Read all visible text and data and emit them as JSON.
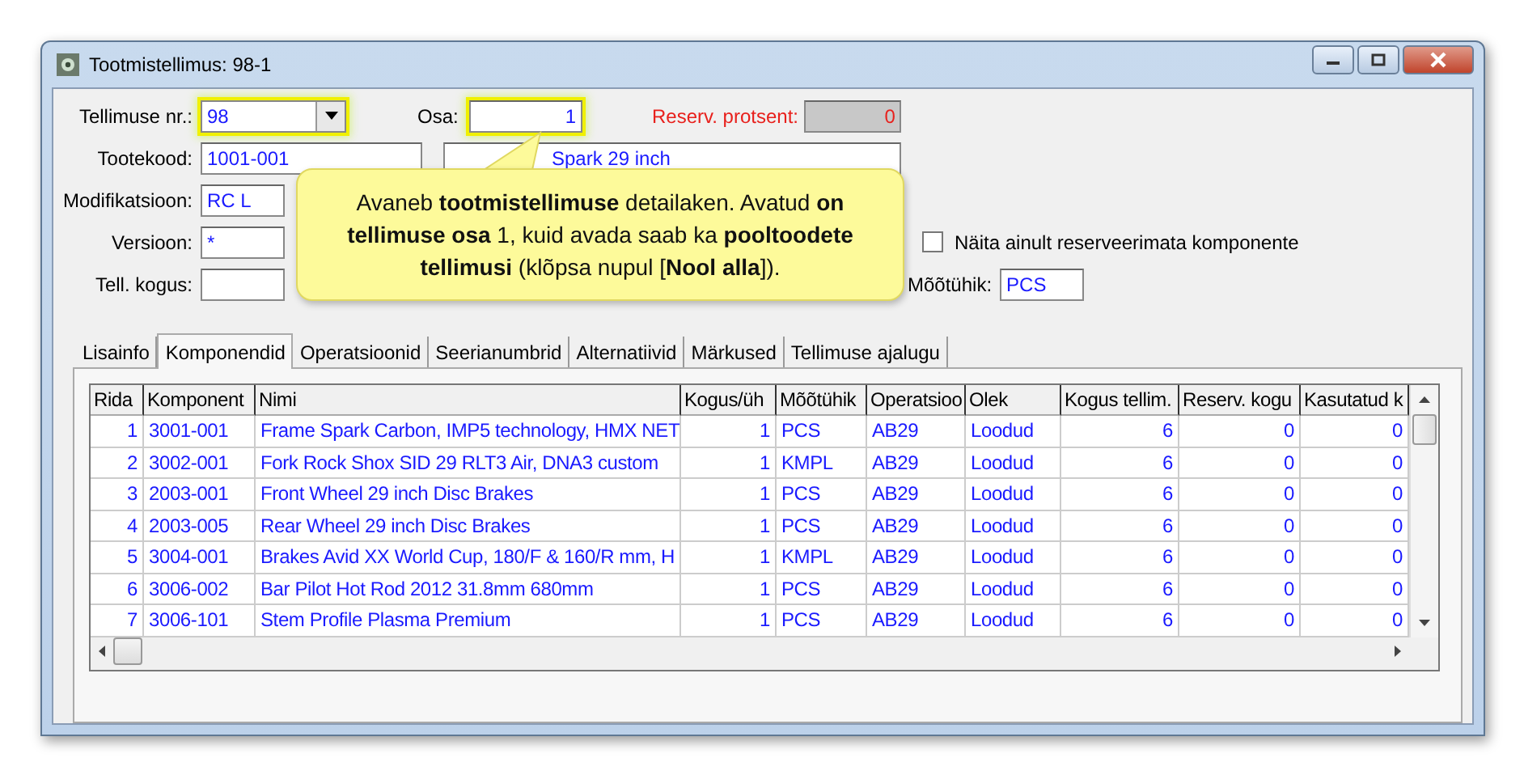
{
  "window": {
    "title": "Tootmistellimus: 98-1"
  },
  "form": {
    "order_no": {
      "label": "Tellimuse nr.:",
      "value": "98",
      "highlighted": true
    },
    "part": {
      "label": "Osa:",
      "value": "1",
      "highlighted": true
    },
    "reserve_percent": {
      "label": "Reserv. protsent:",
      "value": "0",
      "disabled": true
    },
    "product_code": {
      "label": "Tootekood:",
      "value": "1001-001"
    },
    "product_name": {
      "value": "Spark 29 inch"
    },
    "modification": {
      "label": "Modifikatsioon:",
      "value": "RC L"
    },
    "version": {
      "label": "Versioon:",
      "value": "*"
    },
    "quantity": {
      "label": "Tell. kogus:"
    },
    "unreserved_only": {
      "label": "Näita ainult reserveerimata komponente",
      "checked": false
    },
    "unit": {
      "label": "Mõõtühik:",
      "value": "PCS"
    }
  },
  "callout": {
    "text": "Avaneb **tootmistellimuse** detailaken. Avatud **on tellimuse osa** 1, kuid avada saab ka **pooltoodete tellimusi** (klõpsa nupul [**Nool alla**])."
  },
  "tabs": [
    {
      "label": "Lisainfo",
      "selected": false
    },
    {
      "label": "Komponendid",
      "selected": true
    },
    {
      "label": "Operatsioonid",
      "selected": false
    },
    {
      "label": "Seerianumbrid",
      "selected": false
    },
    {
      "label": "Alternatiivid",
      "selected": false
    },
    {
      "label": "Märkused",
      "selected": false
    },
    {
      "label": "Tellimuse ajalugu",
      "selected": false
    }
  ],
  "table": {
    "columns": [
      "Rida",
      "Komponent",
      "Nimi",
      "Kogus/üh",
      "Mõõtühik",
      "Operatsioo",
      "Olek",
      "Kogus tellim.",
      "Reserv. kogu",
      "Kasutatud k"
    ],
    "rows": [
      [
        "1",
        "3001-001",
        "Frame Spark Carbon, IMP5 technology, HMX NET",
        "1",
        "PCS",
        "AB29",
        "Loodud",
        "6",
        "0",
        "0"
      ],
      [
        "2",
        "3002-001",
        "Fork Rock Shox SID 29 RLT3 Air, DNA3 custom",
        "1",
        "KMPL",
        "AB29",
        "Loodud",
        "6",
        "0",
        "0"
      ],
      [
        "3",
        "2003-001",
        "Front Wheel 29 inch Disc Brakes",
        "1",
        "PCS",
        "AB29",
        "Loodud",
        "6",
        "0",
        "0"
      ],
      [
        "4",
        "2003-005",
        "Rear Wheel 29 inch Disc Brakes",
        "1",
        "PCS",
        "AB29",
        "Loodud",
        "6",
        "0",
        "0"
      ],
      [
        "5",
        "3004-001",
        "Brakes Avid XX World Cup, 180/F & 160/R mm, H",
        "1",
        "KMPL",
        "AB29",
        "Loodud",
        "6",
        "0",
        "0"
      ],
      [
        "6",
        "3006-002",
        "Bar Pilot Hot Rod 2012 31.8mm 680mm",
        "1",
        "PCS",
        "AB29",
        "Loodud",
        "6",
        "0",
        "0"
      ],
      [
        "7",
        "3006-101",
        "Stem Profile Plasma Premium",
        "1",
        "PCS",
        "AB29",
        "Loodud",
        "6",
        "0",
        "0"
      ]
    ]
  }
}
